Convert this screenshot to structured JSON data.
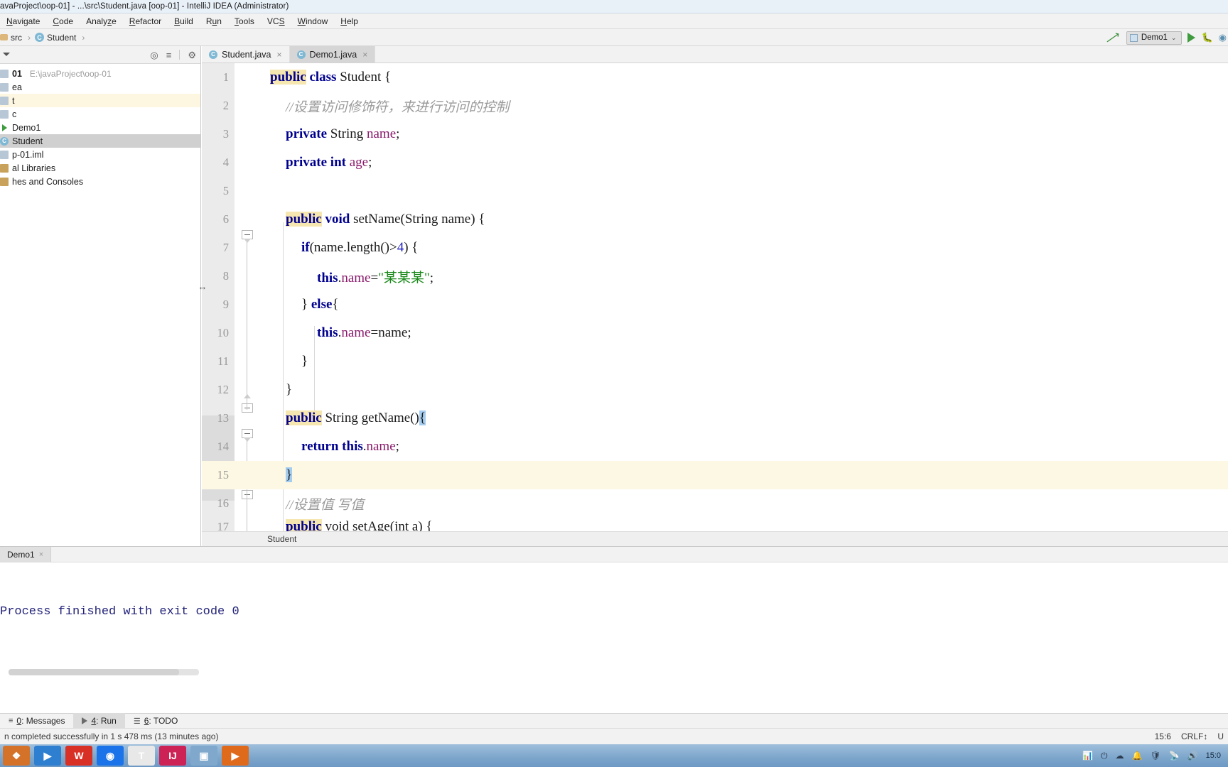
{
  "window": {
    "title": "avaProject\\oop-01] - ...\\src\\Student.java [oop-01] - IntelliJ IDEA (Administrator)"
  },
  "menu": {
    "items": [
      {
        "label": "Navigate",
        "accel": "N"
      },
      {
        "label": "Code",
        "accel": "C"
      },
      {
        "label": "Analyze",
        "accel": "z"
      },
      {
        "label": "Refactor",
        "accel": "R"
      },
      {
        "label": "Build",
        "accel": "B"
      },
      {
        "label": "Run",
        "accel": "u"
      },
      {
        "label": "Tools",
        "accel": "T"
      },
      {
        "label": "VCS",
        "accel": "S"
      },
      {
        "label": "Window",
        "accel": "W"
      },
      {
        "label": "Help",
        "accel": "H"
      }
    ]
  },
  "breadcrumb": {
    "items": [
      "src",
      "Student"
    ],
    "separator": "›"
  },
  "run_config": {
    "name": "Demo1",
    "chevron": "⌄",
    "icons": [
      "up-left-arrow-icon",
      "run-icon",
      "debug-icon",
      "coverage-icon"
    ]
  },
  "project_panel": {
    "header_icons": [
      "target-icon",
      "collapse-all-icon",
      "settings-gear-icon"
    ],
    "tree": [
      {
        "label": "01",
        "path": "E:\\javaProject\\oop-01",
        "icon": "folder-icon",
        "bold": true,
        "state": "normal"
      },
      {
        "label": "ea",
        "icon": "folder-icon",
        "state": "normal"
      },
      {
        "label": "t",
        "icon": "folder-icon",
        "state": "highlight"
      },
      {
        "label": "c",
        "icon": "folder-icon",
        "state": "normal"
      },
      {
        "label": "Demo1",
        "icon": "java-runnable-icon",
        "state": "normal"
      },
      {
        "label": "Student",
        "icon": "java-class-icon",
        "state": "selected"
      },
      {
        "label": "p-01.iml",
        "icon": "file-icon",
        "state": "normal"
      },
      {
        "label": "al Libraries",
        "icon": "library-icon",
        "state": "normal"
      },
      {
        "label": "hes and Consoles",
        "icon": "library-icon",
        "state": "normal"
      }
    ]
  },
  "editor": {
    "tabs": [
      {
        "label": "Student.java",
        "active": false,
        "close": "×"
      },
      {
        "label": "Demo1.java",
        "active": true,
        "close": "×"
      }
    ],
    "breadcrumb_bottom": "Student",
    "lines": [
      {
        "n": "1",
        "indent": 0,
        "tokens": [
          {
            "t": "public",
            "c": "kwhl"
          },
          {
            "t": " ",
            "c": "plain"
          },
          {
            "t": "class",
            "c": "kw"
          },
          {
            "t": " Student {",
            "c": "plain"
          }
        ]
      },
      {
        "n": "2",
        "indent": 1,
        "tokens": [
          {
            "t": "//设置访问修饰符，来进行访问的控制",
            "c": "cmt"
          }
        ]
      },
      {
        "n": "3",
        "indent": 1,
        "tokens": [
          {
            "t": "private",
            "c": "kw"
          },
          {
            "t": " String ",
            "c": "plain"
          },
          {
            "t": "name",
            "c": "fld"
          },
          {
            "t": ";",
            "c": "plain"
          }
        ]
      },
      {
        "n": "4",
        "indent": 1,
        "tokens": [
          {
            "t": "private",
            "c": "kw"
          },
          {
            "t": " ",
            "c": "plain"
          },
          {
            "t": "int",
            "c": "kw"
          },
          {
            "t": " ",
            "c": "plain"
          },
          {
            "t": "age",
            "c": "fld"
          },
          {
            "t": ";",
            "c": "plain"
          }
        ]
      },
      {
        "n": "5",
        "indent": 1,
        "tokens": []
      },
      {
        "n": "6",
        "indent": 1,
        "tokens": [
          {
            "t": "public",
            "c": "kwhl"
          },
          {
            "t": " ",
            "c": "plain"
          },
          {
            "t": "void",
            "c": "kw"
          },
          {
            "t": " setName(String name) {",
            "c": "plain"
          }
        ]
      },
      {
        "n": "7",
        "indent": 2,
        "tokens": [
          {
            "t": "if",
            "c": "kw"
          },
          {
            "t": "(name.length()>",
            "c": "plain"
          },
          {
            "t": "4",
            "c": "num"
          },
          {
            "t": ") {",
            "c": "plain"
          }
        ]
      },
      {
        "n": "8",
        "indent": 3,
        "tokens": [
          {
            "t": "this",
            "c": "kw"
          },
          {
            "t": ".",
            "c": "plain"
          },
          {
            "t": "name",
            "c": "fld"
          },
          {
            "t": "=",
            "c": "plain"
          },
          {
            "t": "\"某某某\"",
            "c": "str"
          },
          {
            "t": ";",
            "c": "plain"
          }
        ]
      },
      {
        "n": "9",
        "indent": 2,
        "tokens": [
          {
            "t": "} ",
            "c": "plain"
          },
          {
            "t": "else",
            "c": "kw"
          },
          {
            "t": "{",
            "c": "plain"
          }
        ]
      },
      {
        "n": "10",
        "indent": 3,
        "tokens": [
          {
            "t": "this",
            "c": "kw"
          },
          {
            "t": ".",
            "c": "plain"
          },
          {
            "t": "name",
            "c": "fld"
          },
          {
            "t": "=name;",
            "c": "plain"
          }
        ]
      },
      {
        "n": "11",
        "indent": 2,
        "tokens": [
          {
            "t": "}",
            "c": "plain"
          }
        ]
      },
      {
        "n": "12",
        "indent": 1,
        "tokens": [
          {
            "t": "}",
            "c": "plain"
          }
        ]
      },
      {
        "n": "13",
        "indent": 1,
        "tokens": [
          {
            "t": "public",
            "c": "kwhl"
          },
          {
            "t": " String getName()",
            "c": "plain"
          },
          {
            "t": "{",
            "c": "brace-hl"
          }
        ]
      },
      {
        "n": "14",
        "indent": 2,
        "tokens": [
          {
            "t": "return",
            "c": "kw"
          },
          {
            "t": " ",
            "c": "plain"
          },
          {
            "t": "this",
            "c": "kw"
          },
          {
            "t": ".",
            "c": "plain"
          },
          {
            "t": "name",
            "c": "fld"
          },
          {
            "t": ";",
            "c": "plain"
          }
        ]
      },
      {
        "n": "15",
        "indent": 1,
        "current": true,
        "tokens": [
          {
            "t": "}",
            "c": "brace-hl"
          }
        ]
      },
      {
        "n": "16",
        "indent": 1,
        "tokens": [
          {
            "t": "//设置值 写值",
            "c": "cmt"
          }
        ]
      },
      {
        "n": "17",
        "indent": 1,
        "clipped": true,
        "tokens": [
          {
            "t": "public",
            "c": "kwhl"
          },
          {
            "t": " void setAge(int a) {",
            "c": "plain"
          }
        ]
      }
    ]
  },
  "run_window": {
    "tab_label": "Demo1",
    "tab_close": "×",
    "console_output": "Process finished with exit code 0"
  },
  "tool_windows": [
    {
      "num": "0",
      "label": "Messages",
      "icon": "messages-icon",
      "active": false
    },
    {
      "num": "4",
      "label": "Run",
      "icon": "run-triangle-icon",
      "active": true
    },
    {
      "num": "6",
      "label": "TODO",
      "icon": "todo-list-icon",
      "active": false
    }
  ],
  "status_bar": {
    "left": "n completed successfully in 1 s 478 ms (13 minutes ago)",
    "caret": "15:6",
    "line_sep": "CRLF",
    "line_sep_arrow": "↕",
    "encoding": "U"
  },
  "taskbar": {
    "buttons": [
      {
        "name": "start-button",
        "glyph": "❖",
        "color": "#d4722a"
      },
      {
        "name": "media-player-button",
        "glyph": "▶",
        "color": "#2f7fd0"
      },
      {
        "name": "wps-button",
        "glyph": "W",
        "color": "#d93025"
      },
      {
        "name": "browser-button",
        "glyph": "◉",
        "color": "#1a73e8"
      },
      {
        "name": "notes-button",
        "glyph": "T",
        "color": "#e8e8e8"
      },
      {
        "name": "intellij-button",
        "glyph": "IJ",
        "color": "#cc2255"
      },
      {
        "name": "explorer-button",
        "glyph": "▣",
        "color": "#7fa8cc"
      },
      {
        "name": "video-button",
        "glyph": "▶",
        "color": "#e06a1c"
      }
    ],
    "tray": [
      "chart-icon",
      "usb-icon",
      "cloud-icon",
      "bell-icon",
      "shield-icon",
      "network-icon",
      "volume-icon"
    ],
    "clock": "15:0"
  },
  "colors": {
    "keyword": "#00008f",
    "field": "#8a1a6b",
    "string": "#1a8a1a",
    "comment": "#9a9a9a",
    "number": "#2020c0",
    "current_line_bg": "#fdf8e3",
    "keyword_highlight_bg": "#f6e6b0",
    "brace_match_bg": "#a5cdf0",
    "accent_green": "#3e9b3e"
  }
}
